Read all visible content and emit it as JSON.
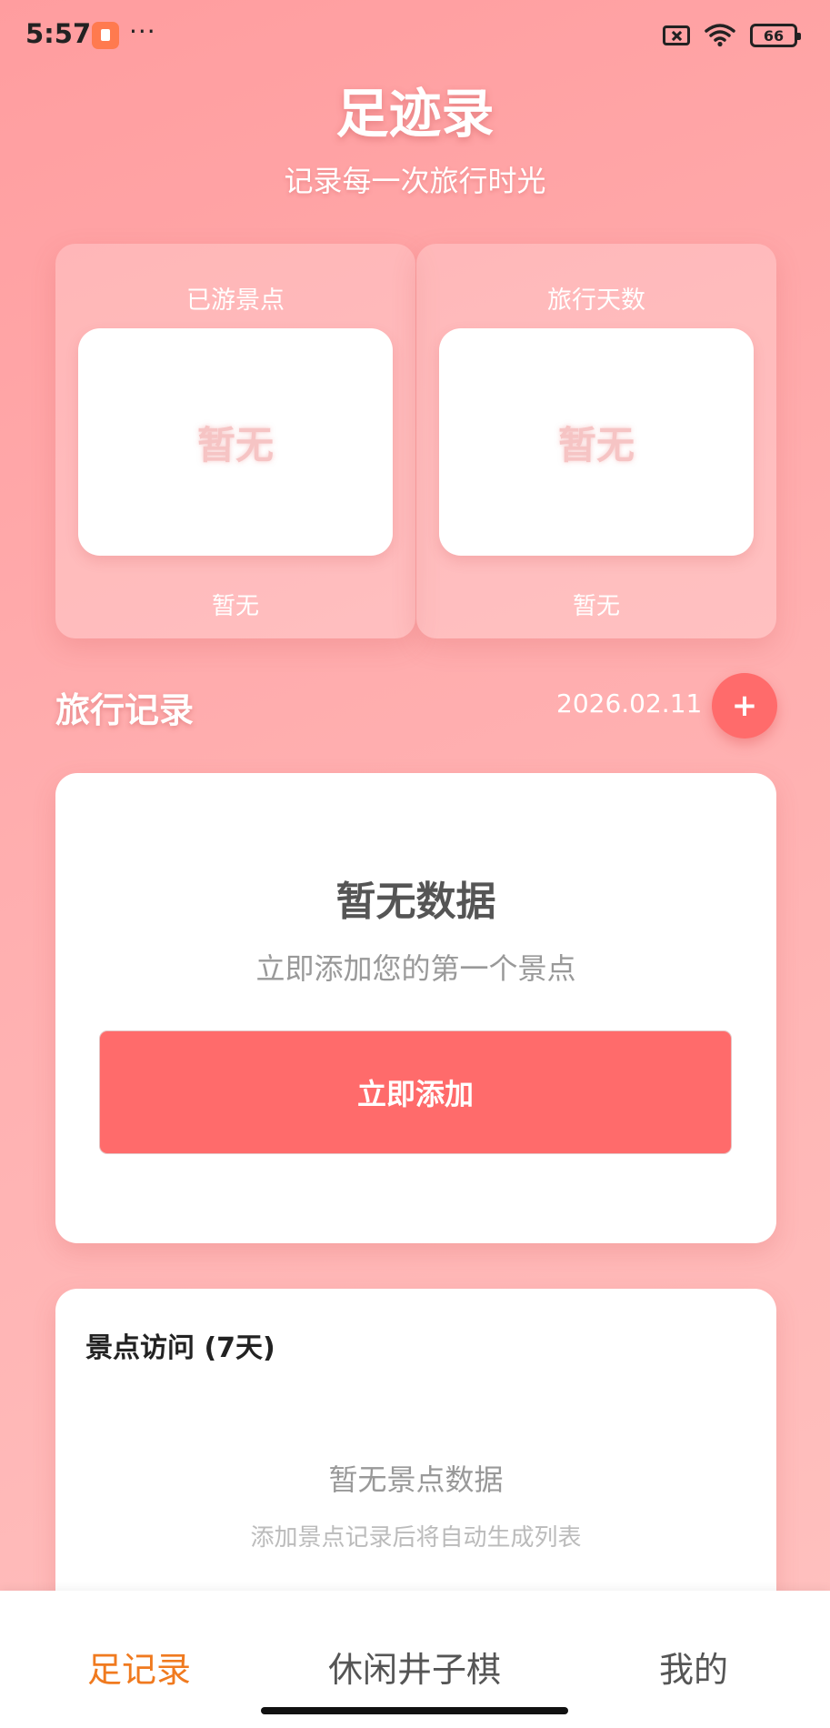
{
  "status_bar": {
    "time": "5:57",
    "dots": "···",
    "battery": "66"
  },
  "header": {
    "title": "足迹录",
    "subtitle": "记录每一次旅行时光"
  },
  "stats": [
    {
      "label": "已游景点",
      "value": "暂无",
      "foot": "暂无"
    },
    {
      "label": "旅行天数",
      "value": "暂无",
      "foot": "暂无"
    }
  ],
  "records": {
    "title": "旅行记录",
    "date": "2026.02.11",
    "add_icon": "+"
  },
  "empty_state": {
    "title": "暂无数据",
    "subtitle": "立即添加您的第一个景点",
    "button": "立即添加"
  },
  "visits": {
    "title": "景点访问 (7天)",
    "empty": "暂无景点数据",
    "hint": "添加景点记录后将自动生成列表"
  },
  "nav": {
    "items": [
      {
        "label": "足记录"
      },
      {
        "label": "休闲井子棋"
      },
      {
        "label": "我的"
      }
    ]
  },
  "colors": {
    "accent": "#ff6b6b",
    "nav_active": "#f07a1f"
  }
}
